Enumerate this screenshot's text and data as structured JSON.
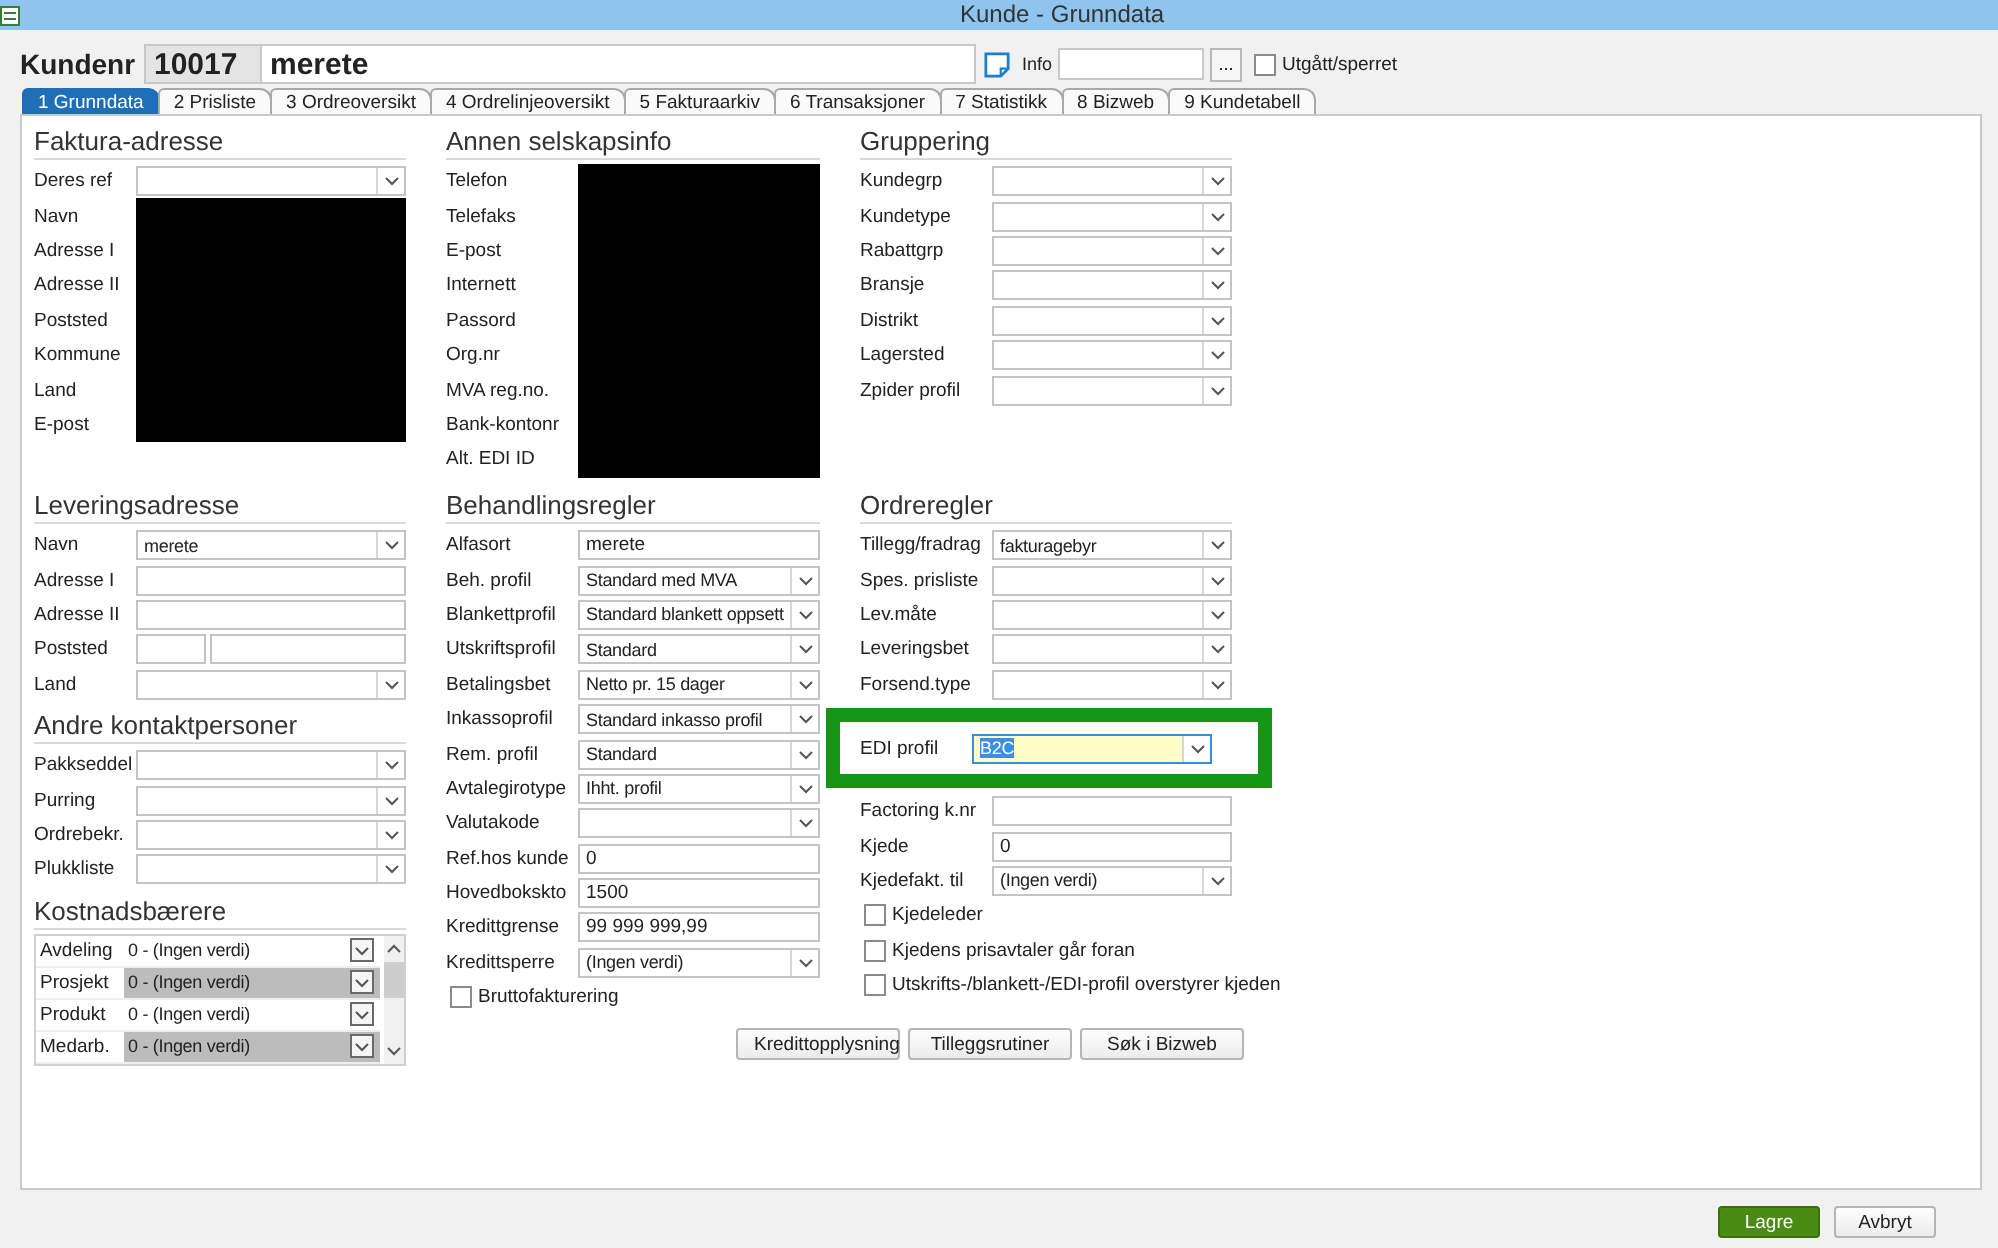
{
  "window": {
    "title": "Kunde - Grunndata"
  },
  "header": {
    "label": "Kundenr",
    "number": "10017",
    "name": "merete",
    "info_label": "Info",
    "info_button": "...",
    "blocked": {
      "label": "Utgått/sperret",
      "checked": false
    }
  },
  "tabs": [
    {
      "label": "1 Grunndata",
      "selected": true
    },
    {
      "label": "2 Prisliste",
      "selected": false
    },
    {
      "label": "3 Ordreoversikt",
      "selected": false
    },
    {
      "label": "4 Ordrelinjeoversikt",
      "selected": false
    },
    {
      "label": "5 Fakturaarkiv",
      "selected": false
    },
    {
      "label": "6 Transaksjoner",
      "selected": false
    },
    {
      "label": "7 Statistikk",
      "selected": false
    },
    {
      "label": "8 Bizweb",
      "selected": false
    },
    {
      "label": "9 Kundetabell",
      "selected": false
    }
  ],
  "columns": [
    {
      "sections": [
        {
          "title": "Faktura-adresse",
          "kind": "form",
          "rows": [
            {
              "kind": "select",
              "label": "Deres ref"
            },
            {
              "kind": "redacted",
              "label": "Navn"
            },
            {
              "kind": "redacted",
              "label": "Adresse I"
            },
            {
              "kind": "redacted",
              "label": "Adresse II"
            },
            {
              "kind": "redacted",
              "label": "Poststed"
            },
            {
              "kind": "redacted",
              "label": "Kommune"
            },
            {
              "kind": "redacted",
              "label": "Land"
            },
            {
              "kind": "redacted",
              "label": "E-post"
            }
          ]
        },
        {
          "title": "Leveringsadresse",
          "kind": "form",
          "rows": [
            {
              "kind": "select",
              "label": "Navn",
              "value": "merete"
            },
            {
              "kind": "text",
              "label": "Adresse I"
            },
            {
              "kind": "text",
              "label": "Adresse II"
            },
            {
              "kind": "split",
              "label": "Poststed"
            },
            {
              "kind": "select",
              "label": "Land"
            }
          ]
        },
        {
          "title": "Andre kontaktpersoner",
          "kind": "form",
          "rows": [
            {
              "kind": "select",
              "label": "Pakkseddel"
            },
            {
              "kind": "select",
              "label": "Purring"
            },
            {
              "kind": "select",
              "label": "Ordrebekr."
            },
            {
              "kind": "select",
              "label": "Plukkliste"
            }
          ]
        },
        {
          "title": "Kostnadsbærere",
          "kind": "grid",
          "rows": [
            {
              "label": "Avdeling",
              "value": "0 - (Ingen verdi)",
              "disabled": false
            },
            {
              "label": "Prosjekt",
              "value": "0 - (Ingen verdi)",
              "disabled": true
            },
            {
              "label": "Produkt",
              "value": "0 - (Ingen verdi)",
              "disabled": false
            },
            {
              "label": "Medarb.",
              "value": "0 - (Ingen verdi)",
              "disabled": true
            }
          ]
        }
      ]
    },
    {
      "sections": [
        {
          "title": "Annen selskapsinfo",
          "kind": "form",
          "rows": [
            {
              "kind": "redacted",
              "label": "Telefon"
            },
            {
              "kind": "redacted",
              "label": "Telefaks"
            },
            {
              "kind": "redacted",
              "label": "E-post"
            },
            {
              "kind": "redacted",
              "label": "Internett"
            },
            {
              "kind": "redacted",
              "label": "Passord"
            },
            {
              "kind": "redacted",
              "label": "Org.nr"
            },
            {
              "kind": "redacted",
              "label": "MVA reg.no."
            },
            {
              "kind": "redacted",
              "label": "Bank-kontonr"
            },
            {
              "kind": "redacted",
              "label": "Alt. EDI ID"
            }
          ]
        },
        {
          "title": "Behandlingsregler",
          "kind": "form",
          "rows": [
            {
              "kind": "text",
              "label": "Alfasort",
              "value": "merete"
            },
            {
              "kind": "select",
              "label": "Beh. profil",
              "value": "Standard med MVA"
            },
            {
              "kind": "select",
              "label": "Blankettprofil",
              "value": "Standard blankett oppsett"
            },
            {
              "kind": "select",
              "label": "Utskriftsprofil",
              "value": "Standard"
            },
            {
              "kind": "select",
              "label": "Betalingsbet",
              "value": "Netto pr. 15 dager"
            },
            {
              "kind": "select",
              "label": "Inkassoprofil",
              "value": "Standard inkasso profil"
            },
            {
              "kind": "select",
              "label": "Rem. profil",
              "value": "Standard"
            },
            {
              "kind": "select",
              "label": "Avtalegirotype",
              "value": "Ihht. profil"
            },
            {
              "kind": "select",
              "label": "Valutakode"
            },
            {
              "kind": "text",
              "label": "Ref.hos kunde",
              "value": "0"
            },
            {
              "kind": "text",
              "label": "Hovedbokskto",
              "value": "1500"
            },
            {
              "kind": "text",
              "label": "Kredittgrense",
              "value": "99 999 999,99"
            },
            {
              "kind": "select",
              "label": "Kredittsperre",
              "value": "(Ingen verdi)"
            },
            {
              "kind": "checkbox",
              "label": "Bruttofakturering",
              "checked": false
            }
          ]
        }
      ]
    },
    {
      "sections": [
        {
          "title": "Gruppering",
          "kind": "form",
          "rows": [
            {
              "kind": "select",
              "label": "Kundegrp"
            },
            {
              "kind": "select",
              "label": "Kundetype"
            },
            {
              "kind": "select",
              "label": "Rabattgrp"
            },
            {
              "kind": "select",
              "label": "Bransje"
            },
            {
              "kind": "select",
              "label": "Distrikt"
            },
            {
              "kind": "select",
              "label": "Lagersted"
            },
            {
              "kind": "select",
              "label": "Zpider profil"
            }
          ]
        },
        {
          "title": "Ordreregler",
          "kind": "form",
          "rows": [
            {
              "kind": "select",
              "label": "Tillegg/fradrag",
              "value": "fakturagebyr"
            },
            {
              "kind": "select",
              "label": "Spes. prisliste"
            },
            {
              "kind": "select",
              "label": "Lev.måte"
            },
            {
              "kind": "select",
              "label": "Leveringsbet"
            },
            {
              "kind": "select",
              "label": "Forsend.type"
            },
            {
              "kind": "select",
              "label": "EDI profil",
              "value": "B2C",
              "highlighted": true,
              "focused": true
            },
            {
              "kind": "text",
              "label": "Factoring k.nr"
            },
            {
              "kind": "text",
              "label": "Kjede",
              "value": "0"
            },
            {
              "kind": "select",
              "label": "Kjedefakt. til",
              "value": "(Ingen verdi)"
            },
            {
              "kind": "checkbox",
              "label": "Kjedeleder",
              "checked": false
            },
            {
              "kind": "checkbox",
              "label": "Kjedens prisavtaler går foran",
              "checked": false
            },
            {
              "kind": "checkbox",
              "label": "Utskrifts-/blankett-/EDI-profil overstyrer kjeden",
              "checked": false
            }
          ]
        }
      ]
    }
  ],
  "action_buttons": [
    "Kredittopplysning",
    "Tilleggsrutiner",
    "Søk i Bizweb"
  ],
  "footer_buttons": [
    {
      "label": "Lagre",
      "kind": "primary"
    },
    {
      "label": "Avbryt",
      "kind": "default"
    }
  ]
}
